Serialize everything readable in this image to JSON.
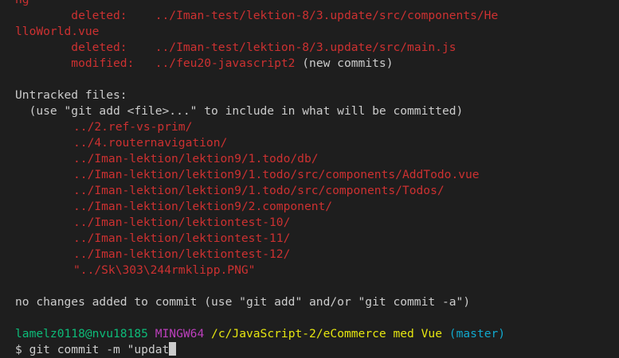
{
  "terminal": {
    "l0": "ng",
    "l1_indent": "        ",
    "l1_status": "deleted:    ",
    "l1_path": "../Iman-test/lektion-8/3.update/src/components/He",
    "l2_path": "lloWorld.vue",
    "l3_indent": "        ",
    "l3_status": "deleted:    ",
    "l3_path": "../Iman-test/lektion-8/3.update/src/main.js",
    "l4_indent": "        ",
    "l4_status": "modified:   ",
    "l4_path": "../feu20-javascript2",
    "l4_note": " (new commits)",
    "untracked_header": "Untracked files:",
    "untracked_hint": "  (use \"git add <file>...\" to include in what will be committed)",
    "untracked_files": [
      "../2.ref-vs-prim/",
      "../4.routernavigation/",
      "../Iman-lektion/lektion9/1.todo/db/",
      "../Iman-lektion/lektion9/1.todo/src/components/AddTodo.vue",
      "../Iman-lektion/lektion9/1.todo/src/components/Todos/",
      "../Iman-lektion/lektion9/2.component/",
      "../Iman-lektion/lektiontest-10/",
      "../Iman-lektion/lektiontest-11/",
      "../Iman-lektion/lektiontest-12/",
      "\"../Sk\\303\\244rmklipp.PNG\""
    ],
    "no_changes": "no changes added to commit (use \"git add\" and/or \"git commit -a\")",
    "prompt": {
      "user_host": "lamelz0118@nvu18185",
      "env": "MINGW64",
      "path": "/c/JavaScript-2/eCommerce med Vue",
      "branch": "(master)"
    },
    "command_line": {
      "symbol": "$ ",
      "text": "git commit -m \"updat"
    }
  },
  "colors": {
    "background": "#1e1e1e",
    "foreground": "#cccccc",
    "red": "#cd3131",
    "green": "#0dbc79",
    "magenta": "#bc3fbc",
    "yellow": "#e5e510",
    "cyan": "#11a8cd"
  }
}
